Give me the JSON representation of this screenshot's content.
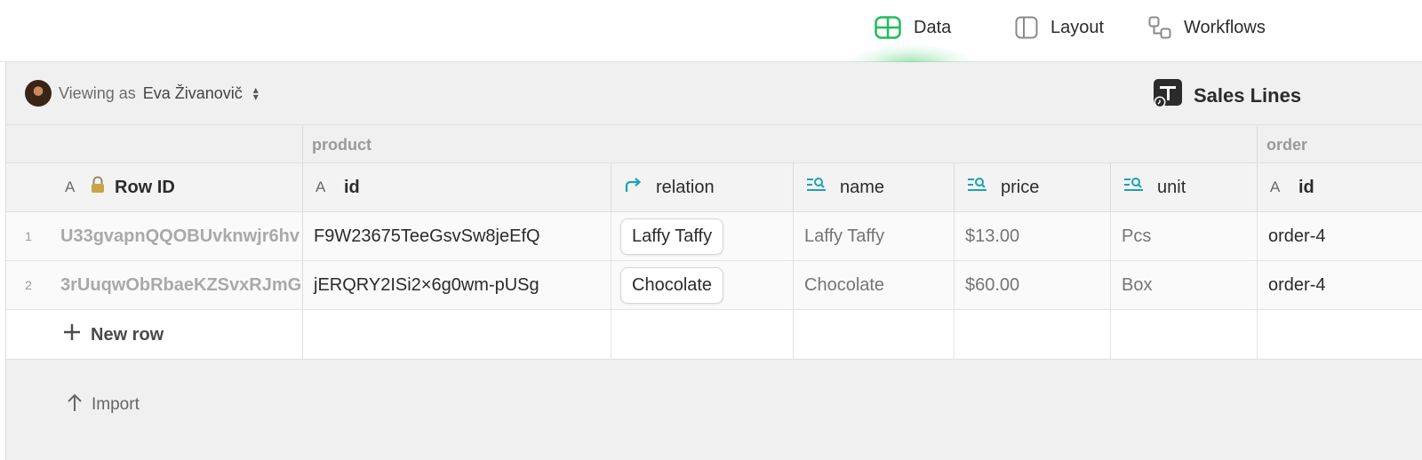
{
  "nav": {
    "tabs": [
      {
        "label": "Data",
        "icon": "table-icon",
        "active": true,
        "accent": "#1ebd5a"
      },
      {
        "label": "Layout",
        "icon": "layout-icon",
        "active": false
      },
      {
        "label": "Workflows",
        "icon": "workflows-icon",
        "active": false
      }
    ]
  },
  "viewing": {
    "prefix": "Viewing as",
    "user": "Eva Živanovič"
  },
  "table_title": "Sales Lines",
  "groups": {
    "product": "product",
    "order": "order"
  },
  "columns": [
    {
      "label": "Row ID",
      "type": "A",
      "locked": true
    },
    {
      "label": "id",
      "type": "A"
    },
    {
      "label": "relation",
      "type": "relation"
    },
    {
      "label": "name",
      "type": "lookup"
    },
    {
      "label": "price",
      "type": "lookup"
    },
    {
      "label": "unit",
      "type": "lookup"
    },
    {
      "label": "id",
      "type": "A"
    }
  ],
  "rows": [
    {
      "num": "1",
      "row_id": "U33gvapnQQOBUvknwjr6hv",
      "id": "F9W23675TeeGsvSw8jeEfQ",
      "relation": "Laffy Taffy",
      "name": "Laffy Taffy",
      "price": "$13.00",
      "unit": "Pcs",
      "order_id": "order-4"
    },
    {
      "num": "2",
      "row_id": "3rUuqwObRbaeKZSvxRJmG",
      "id": "jERQRY2ISi2×6g0wm-pUSg",
      "relation": "Chocolate",
      "name": "Chocolate",
      "price": "$60.00",
      "unit": "Box",
      "order_id": "order-4"
    }
  ],
  "new_row_label": "New row",
  "import_label": "Import",
  "colors": {
    "accent_green": "#1ebd5a",
    "lookup_teal": "#1aa3b5"
  }
}
